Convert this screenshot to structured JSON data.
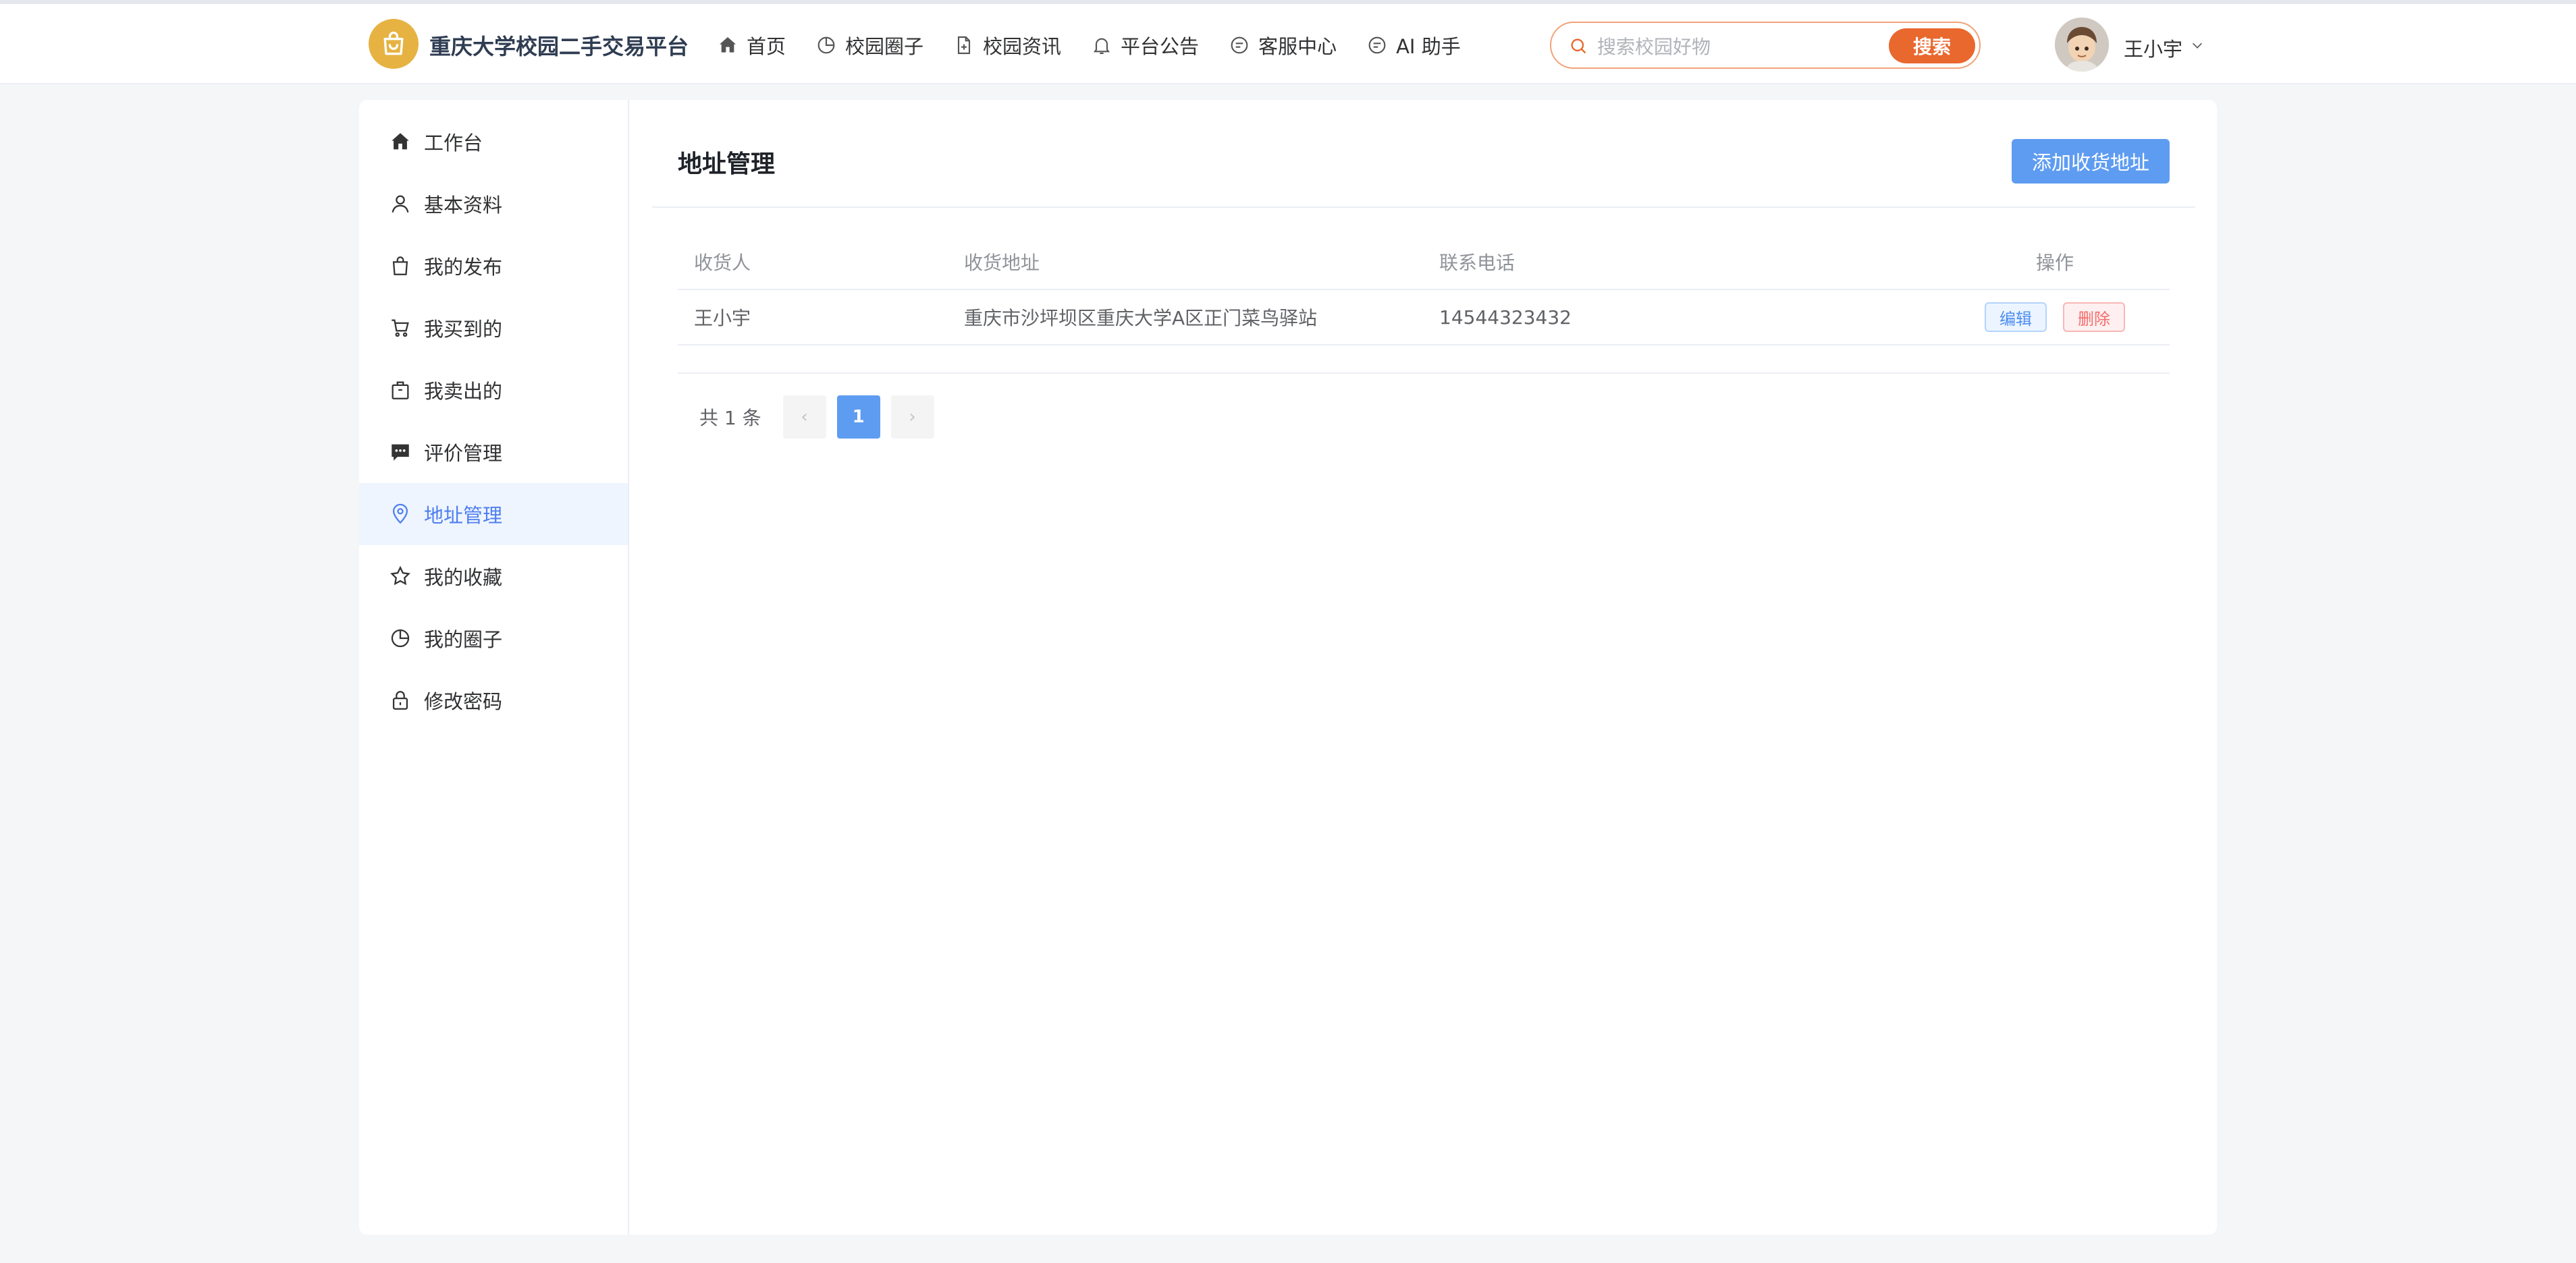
{
  "header": {
    "brand": "重庆大学校园二手交易平台",
    "nav": [
      {
        "label": "首页",
        "icon": "home-icon"
      },
      {
        "label": "校园圈子",
        "icon": "pie-chart-icon"
      },
      {
        "label": "校园资讯",
        "icon": "document-icon"
      },
      {
        "label": "平台公告",
        "icon": "bell-icon"
      },
      {
        "label": "客服中心",
        "icon": "chat-icon"
      },
      {
        "label": "AI 助手",
        "icon": "chat-icon"
      }
    ],
    "search": {
      "placeholder": "搜索校园好物",
      "button": "搜索"
    },
    "user": {
      "name": "王小宇"
    }
  },
  "sidebar": {
    "items": [
      {
        "label": "工作台",
        "icon": "home-icon"
      },
      {
        "label": "基本资料",
        "icon": "user-icon"
      },
      {
        "label": "我的发布",
        "icon": "bag-icon"
      },
      {
        "label": "我买到的",
        "icon": "cart-icon"
      },
      {
        "label": "我卖出的",
        "icon": "box-icon"
      },
      {
        "label": "评价管理",
        "icon": "comment-icon"
      },
      {
        "label": "地址管理",
        "icon": "location-icon",
        "active": true
      },
      {
        "label": "我的收藏",
        "icon": "star-icon"
      },
      {
        "label": "我的圈子",
        "icon": "pie-chart-icon"
      },
      {
        "label": "修改密码",
        "icon": "lock-icon"
      }
    ]
  },
  "main": {
    "title": "地址管理",
    "add_button": "添加收货地址",
    "table": {
      "headers": [
        "收货人",
        "收货地址",
        "联系电话",
        "操作"
      ],
      "rows": [
        {
          "name": "王小宇",
          "address": "重庆市沙坪坝区重庆大学A区正门菜鸟驿站",
          "phone": "14544323432",
          "edit": "编辑",
          "delete": "删除"
        }
      ]
    },
    "pagination": {
      "total": "共 1 条",
      "current": "1",
      "prev": "‹",
      "next": "›"
    }
  },
  "colors": {
    "accent": "#5e9cf1",
    "search_button": "#e9682e",
    "logo": "#e6b343",
    "active_bg": "#eef5fe"
  }
}
